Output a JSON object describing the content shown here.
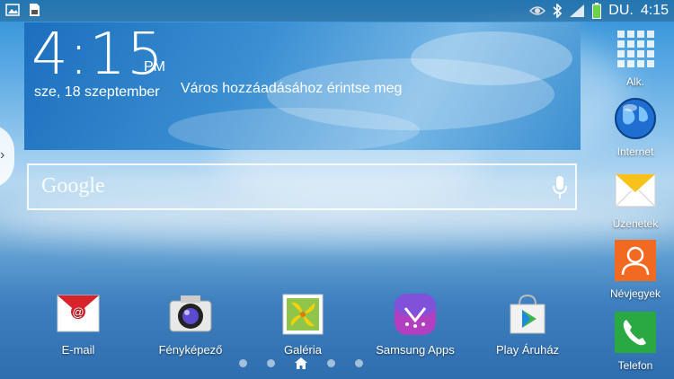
{
  "status_bar": {
    "left_icons": [
      "image-icon",
      "sim-card-icon"
    ],
    "right_icons": [
      "eye-icon",
      "bluetooth-icon",
      "signal-icon",
      "battery-icon"
    ],
    "period": "DU.",
    "time": "4:15"
  },
  "clock_widget": {
    "time": "4:15",
    "ampm": "PM",
    "date": "sze, 18 szeptember",
    "weather_prompt": "Város hozzáadásához érintse meg"
  },
  "search": {
    "label": "Google",
    "icon": "mic-icon"
  },
  "dock": [
    {
      "label": "E-mail",
      "icon": "email-icon"
    },
    {
      "label": "Fényképező",
      "icon": "camera-icon"
    },
    {
      "label": "Galéria",
      "icon": "gallery-icon"
    },
    {
      "label": "Samsung Apps",
      "icon": "samsung-apps-icon"
    },
    {
      "label": "Play Áruház",
      "icon": "play-store-icon"
    }
  ],
  "right_column": [
    {
      "label": "Alk.",
      "icon": "apps-grid-icon"
    },
    {
      "label": "Internet",
      "icon": "globe-icon"
    },
    {
      "label": "Üzenetek",
      "icon": "messages-icon"
    },
    {
      "label": "Névjegyek",
      "icon": "contacts-icon"
    },
    {
      "label": "Telefon",
      "icon": "phone-icon"
    }
  ],
  "colors": {
    "email": "#d9232a",
    "contacts": "#f26a22",
    "phone": "#2aa841",
    "battery": "#6fd14b"
  },
  "pager": {
    "pages": 5,
    "current": 3
  }
}
